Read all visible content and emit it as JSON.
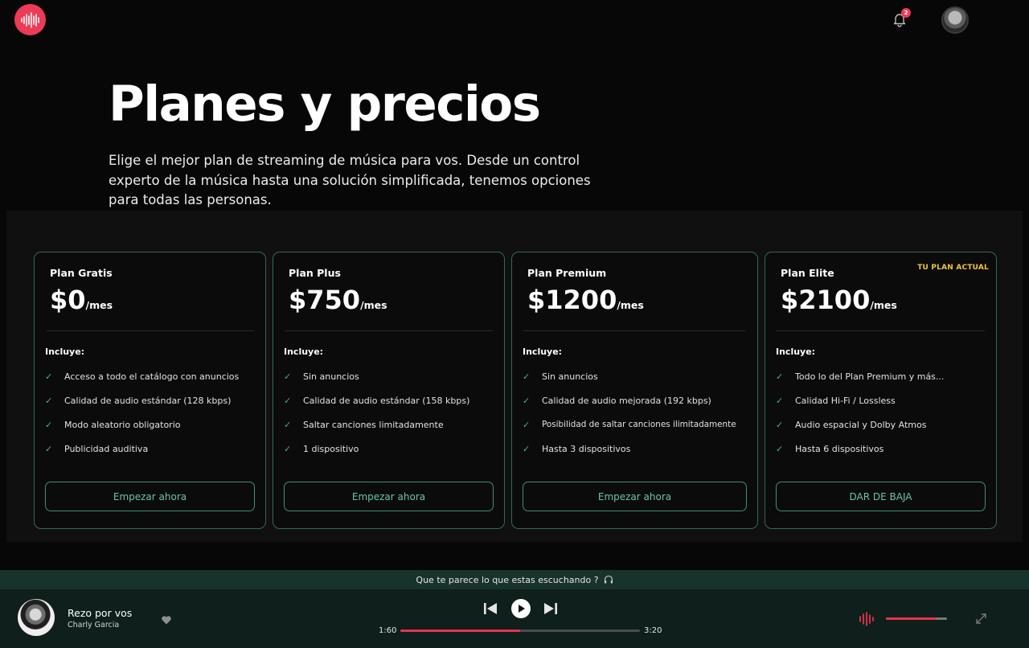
{
  "header": {
    "logo_icon": "soundwave-logo-icon",
    "notification_count": "2",
    "brand_color": "#ec3b57"
  },
  "hero": {
    "title": "Planes y precios",
    "description": "Elige el mejor plan de streaming de música para vos. Desde un control experto de la música hasta una solución simplificada, tenemos opciones para todas las personas."
  },
  "plans": [
    {
      "name": "Plan Gratis",
      "price": "$0",
      "period": "/mes",
      "includes_label": "Incluye:",
      "features": [
        "Acceso a todo el catálogo con anuncios",
        "Calidad de audio estándar (128 kbps)",
        "Modo aleatorio obligatorio",
        "Publicidad auditiva"
      ],
      "button_label": "Empezar ahora",
      "badge": ""
    },
    {
      "name": "Plan Plus",
      "price": "$750",
      "period": "/mes",
      "includes_label": "Incluye:",
      "features": [
        "Sin anuncios",
        "Calidad de audio estándar (158 kbps)",
        "Saltar canciones limitadamente",
        "1 dispositivo"
      ],
      "button_label": "Empezar ahora",
      "badge": ""
    },
    {
      "name": "Plan Premium",
      "price": "$1200",
      "period": "/mes",
      "includes_label": "Incluye:",
      "features": [
        "Sin anuncios",
        "Calidad de audio mejorada (192 kbps)",
        "Posibilidad de saltar canciones ilimitadamente",
        "Hasta 3 dispositivos"
      ],
      "button_label": "Empezar ahora",
      "badge": ""
    },
    {
      "name": "Plan Elite",
      "price": "$2100",
      "period": "/mes",
      "includes_label": "Incluye:",
      "features": [
        "Todo lo del Plan Premium y más...",
        "Calidad Hi-Fi / Lossless",
        "Audio espacial y Dolby Atmos",
        "Hasta 6 dispositivos"
      ],
      "button_label": "DAR DE BAJA",
      "badge": "TU PLAN ACTUAL"
    }
  ],
  "feedback": {
    "text": "Que te parece lo que estas escuchando ?",
    "icon": "headphones-icon"
  },
  "player": {
    "track_title": "Rezo por vos",
    "artist": "Charly Garcia",
    "time_current": "1:60",
    "time_total": "3:20",
    "progress": 0.5,
    "volume": 0.83,
    "accent_color": "#e8334f"
  }
}
